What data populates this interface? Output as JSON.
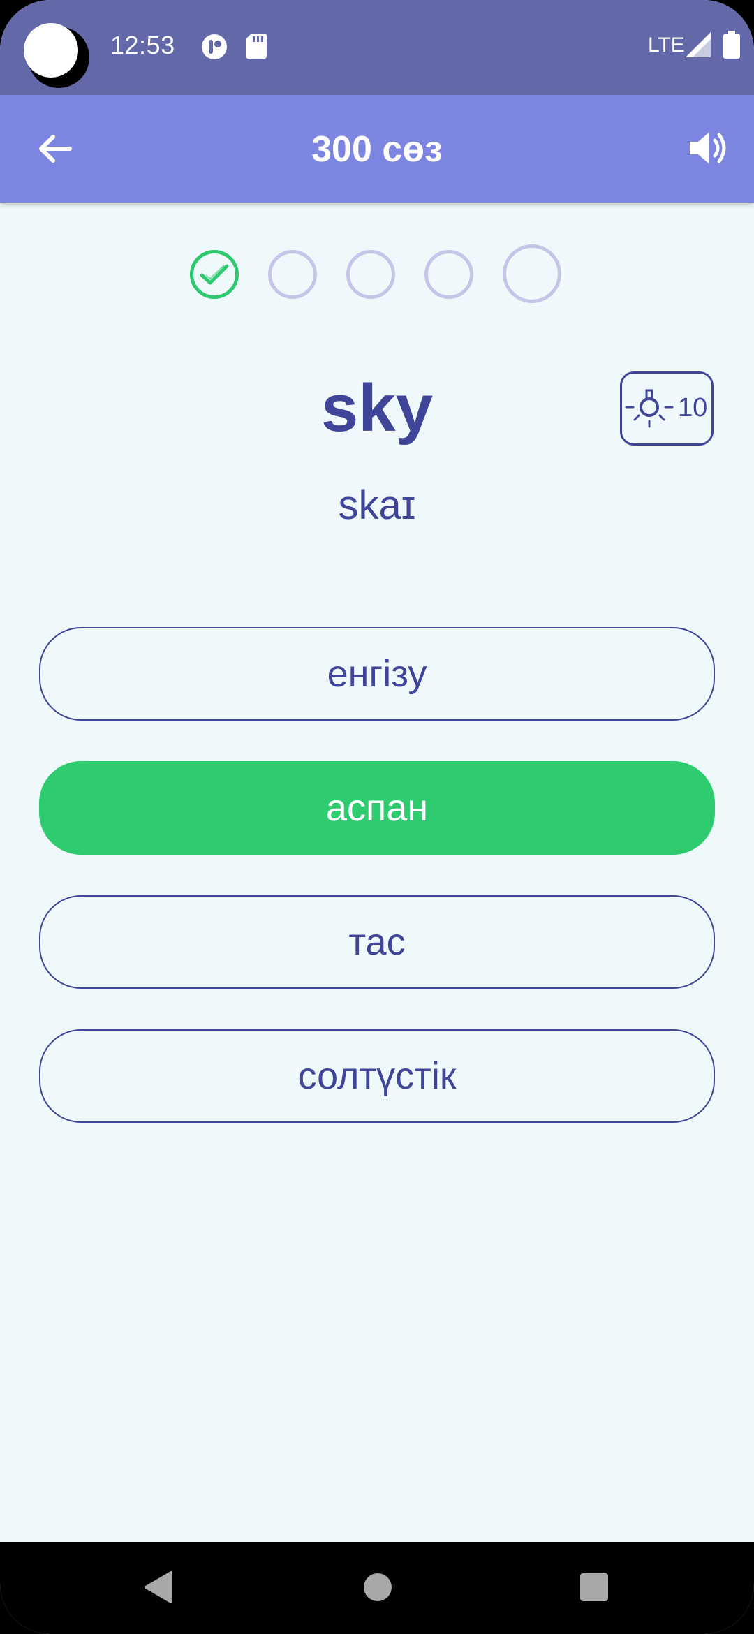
{
  "status_bar": {
    "time": "12:53",
    "network": "LTE",
    "icons": [
      "camera-cutout",
      "app-notification-icon",
      "sd-card-icon",
      "signal-icon",
      "battery-icon"
    ]
  },
  "app_bar": {
    "title": "300 сөз",
    "back_icon": "arrow-left-icon",
    "sound_icon": "speaker-icon"
  },
  "progress": {
    "steps": [
      {
        "state": "done"
      },
      {
        "state": "pending"
      },
      {
        "state": "pending"
      },
      {
        "state": "pending"
      },
      {
        "state": "current"
      }
    ]
  },
  "question": {
    "word": "sky",
    "transcription": "skaɪ"
  },
  "hint": {
    "icon": "lightbulb-icon",
    "count": "10"
  },
  "options": [
    {
      "label": "енгізу",
      "state": "default"
    },
    {
      "label": "аспан",
      "state": "correct"
    },
    {
      "label": "тас",
      "state": "default"
    },
    {
      "label": "солтүстік",
      "state": "default"
    }
  ],
  "colors": {
    "status_bar": "#6369a8",
    "app_bar": "#7c85e0",
    "background": "#eff9fb",
    "primary_text": "#3f4599",
    "correct": "#2ecb6f",
    "pending_dot": "#c3c6e6"
  },
  "nav_bar": {
    "icons": [
      "back-triangle-icon",
      "home-circle-icon",
      "recents-square-icon"
    ]
  }
}
